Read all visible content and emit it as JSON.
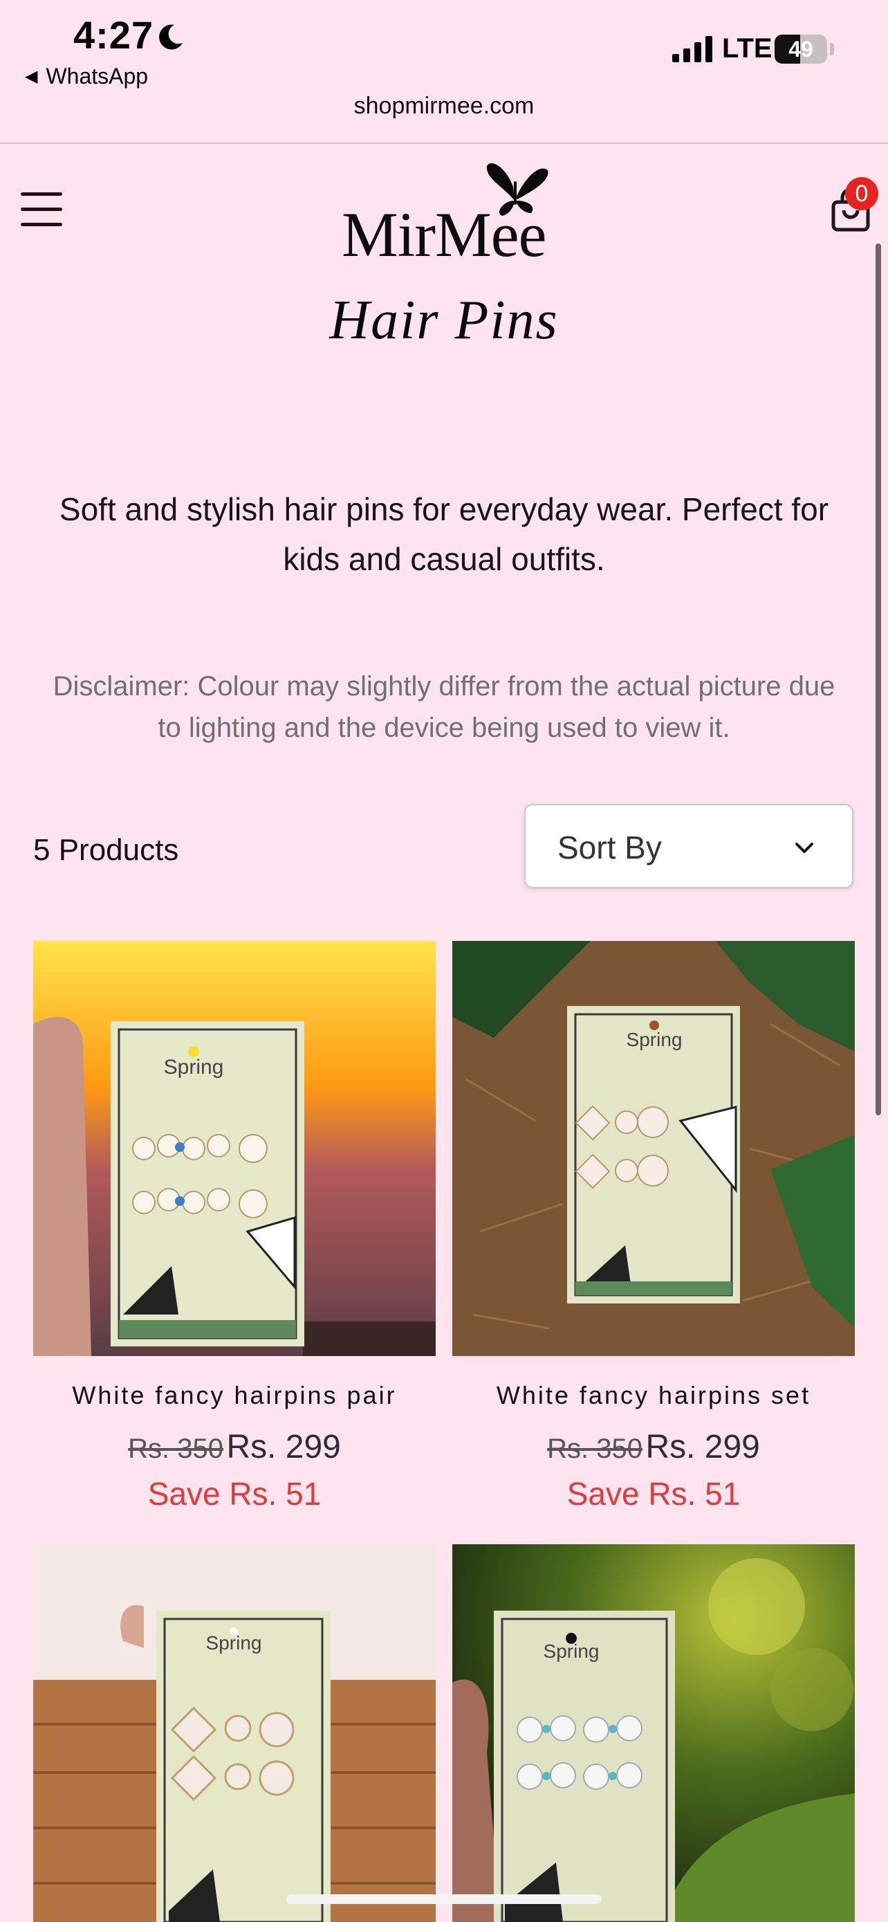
{
  "status_bar": {
    "time": "4:27",
    "back_app": "WhatsApp",
    "network": "LTE",
    "battery": "49",
    "battery_level": 0.49
  },
  "browser": {
    "url": "shopmirmee.com"
  },
  "header": {
    "logo_text": "MirMee",
    "cart_count": "0"
  },
  "collection": {
    "title": "Hair Pins",
    "description": "Soft and stylish hair pins for everyday wear. Perfect for kids and casual outfits.",
    "disclaimer": "Disclaimer: Colour may slightly differ from the actual picture due to lighting and the device being used to view it."
  },
  "toolbar": {
    "product_count": "5 Products",
    "sort_label": "Sort By"
  },
  "products": [
    {
      "name": "White fancy hairpins pair",
      "old_price": "Rs. 350",
      "price": "Rs. 299",
      "save": "Save Rs. 51",
      "card_label": "Spring"
    },
    {
      "name": "White fancy hairpins set",
      "old_price": "Rs. 350",
      "price": "Rs. 299",
      "save": "Save Rs. 51",
      "card_label": "Spring"
    },
    {
      "name": "",
      "card_label": "Spring"
    },
    {
      "name": "",
      "card_label": "Spring"
    }
  ],
  "colors": {
    "page_bg": "#fde4ee",
    "sale_red": "#e23a3a",
    "badge_red": "#e8231f"
  }
}
